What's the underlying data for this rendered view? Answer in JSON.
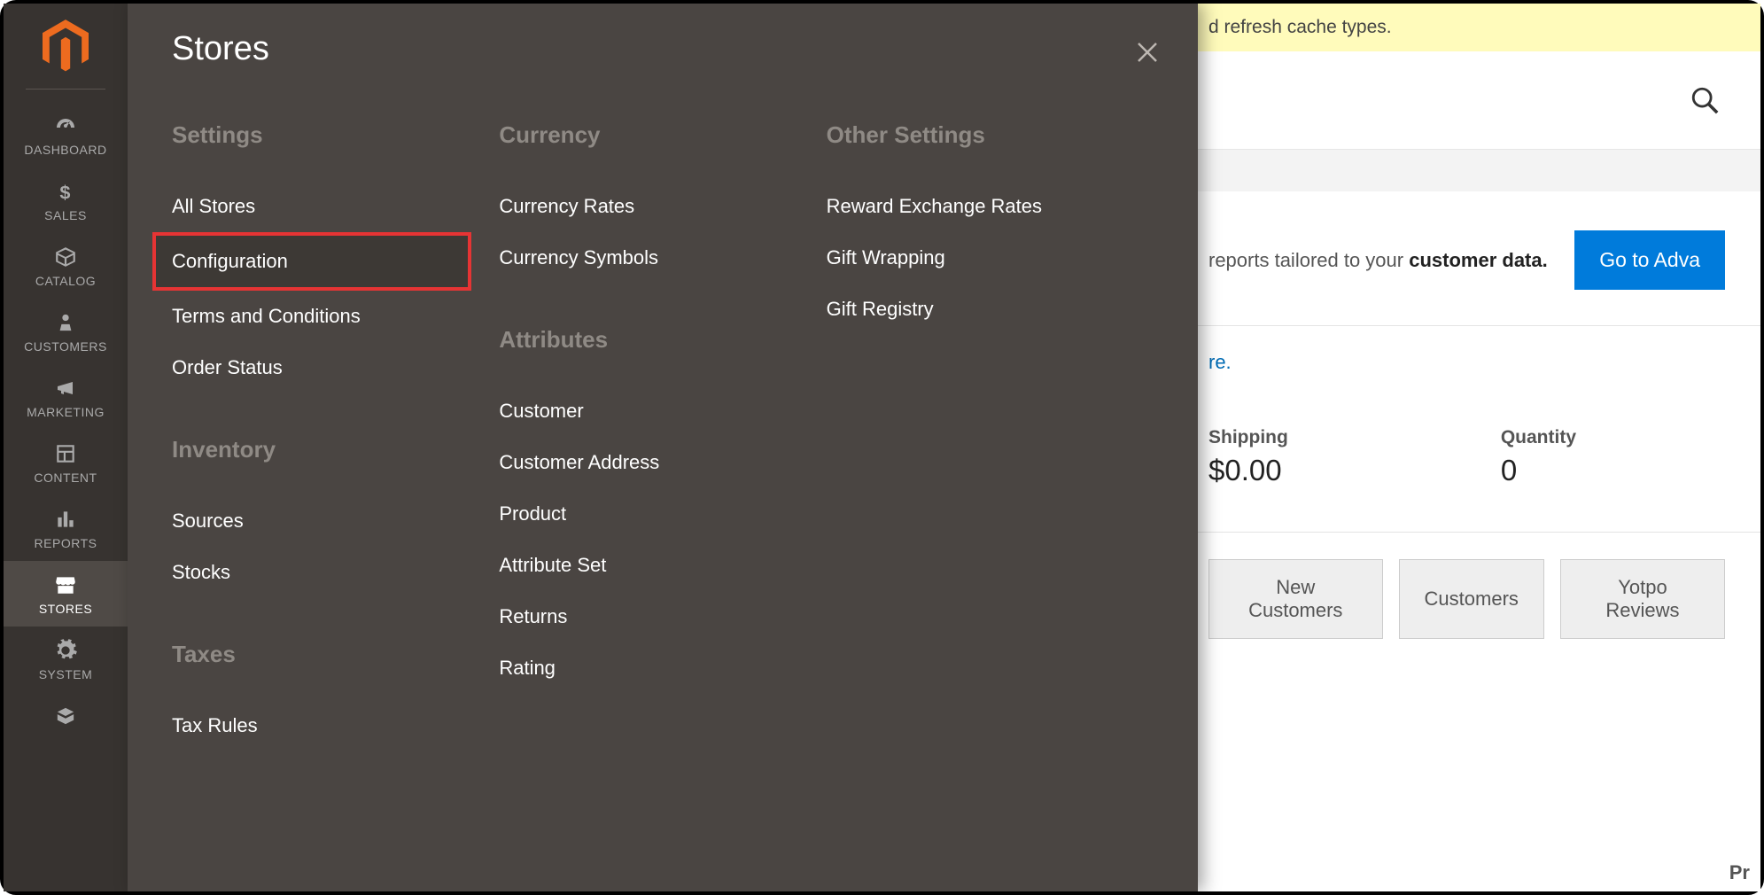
{
  "sidebar": {
    "items": [
      {
        "label": "DASHBOARD"
      },
      {
        "label": "SALES"
      },
      {
        "label": "CATALOG"
      },
      {
        "label": "CUSTOMERS"
      },
      {
        "label": "MARKETING"
      },
      {
        "label": "CONTENT"
      },
      {
        "label": "REPORTS"
      },
      {
        "label": "STORES"
      },
      {
        "label": "SYSTEM"
      }
    ]
  },
  "flyout": {
    "title": "Stores",
    "columns": [
      {
        "groups": [
          {
            "heading": "Settings",
            "links": [
              "All Stores",
              "Configuration",
              "Terms and Conditions",
              "Order Status"
            ]
          },
          {
            "heading": "Inventory",
            "links": [
              "Sources",
              "Stocks"
            ]
          },
          {
            "heading": "Taxes",
            "links": [
              "Tax Rules"
            ]
          }
        ]
      },
      {
        "groups": [
          {
            "heading": "Currency",
            "links": [
              "Currency Rates",
              "Currency Symbols"
            ]
          },
          {
            "heading": "Attributes",
            "links": [
              "Customer",
              "Customer Address",
              "Product",
              "Attribute Set",
              "Returns",
              "Rating"
            ]
          }
        ]
      },
      {
        "groups": [
          {
            "heading": "Other Settings",
            "links": [
              "Reward Exchange Rates",
              "Gift Wrapping",
              "Gift Registry"
            ]
          }
        ]
      }
    ],
    "highlighted_link": "Configuration"
  },
  "background": {
    "notice_text": "d refresh cache types.",
    "promo_text_before": "reports tailored to your ",
    "promo_text_bold": "customer data.",
    "promo_button": "Go to Adva",
    "link_text": "re.",
    "stats": [
      {
        "label": "Shipping",
        "value": "$0.00"
      },
      {
        "label": "Quantity",
        "value": "0"
      }
    ],
    "tabs": [
      "New Customers",
      "Customers",
      "Yotpo Reviews"
    ],
    "footer_right": "Pr"
  }
}
